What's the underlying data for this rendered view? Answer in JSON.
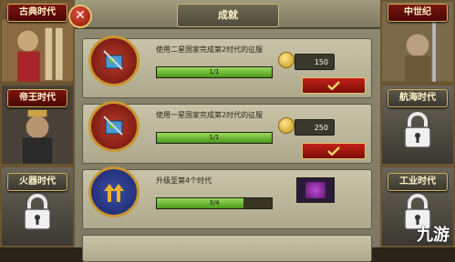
{
  "title": "成就",
  "left_eras": [
    {
      "label": "古典时代",
      "locked": false
    },
    {
      "label": "帝王时代",
      "locked": false
    },
    {
      "label": "火器时代",
      "locked": true
    }
  ],
  "right_eras": [
    {
      "label": "中世纪",
      "locked": false
    },
    {
      "label": "航海时代",
      "locked": true
    },
    {
      "label": "工业时代",
      "locked": true
    }
  ],
  "achievements": [
    {
      "desc": "使用二星国家完成第2时代的征服",
      "progress_text": "1/1",
      "progress": 1,
      "reward": "150",
      "medal": "red"
    },
    {
      "desc": "使用一星国家完成第2时代的征服",
      "progress_text": "1/1",
      "progress": 1,
      "reward": "250",
      "medal": "red"
    },
    {
      "desc": "升级至第4个时代",
      "progress_text": "3/4",
      "progress": 0.75,
      "reward": "",
      "medal": "blue"
    }
  ],
  "watermark": "九游"
}
